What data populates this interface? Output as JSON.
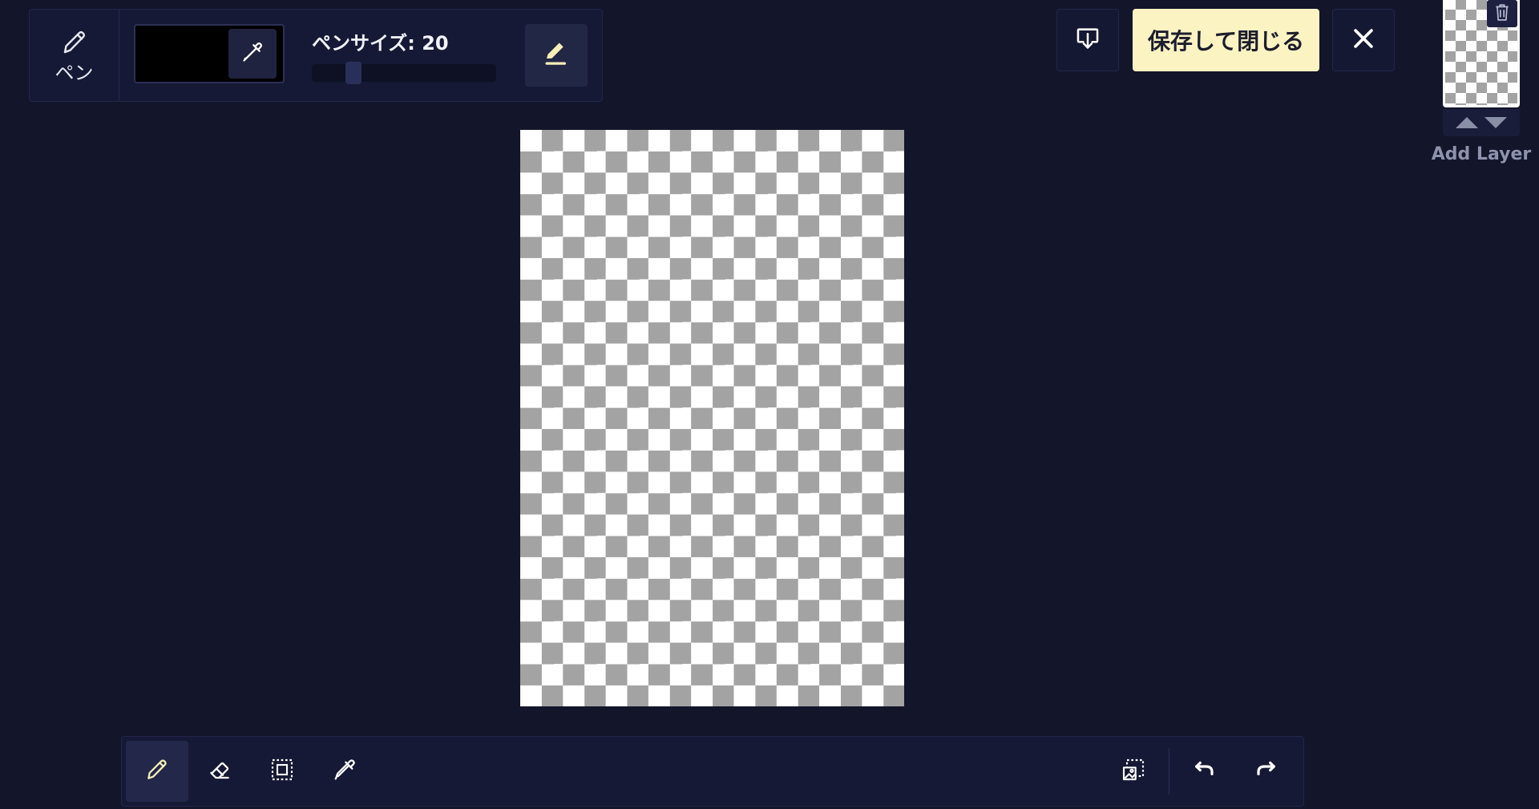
{
  "toolOptions": {
    "currentToolLabel": "ペン",
    "penSizeLabel": "ペンサイズ: 20",
    "penSizeValue": 20,
    "penSizeMax": 100,
    "currentColor": "#000000"
  },
  "actions": {
    "saveLabel": "保存して閉じる"
  },
  "layers": {
    "addLayerLabel": "Add Layer"
  },
  "colors": {
    "background": "#13152b",
    "panel": "#161935",
    "saveButton": "#fcf3c2",
    "accentIcon": "#f6efb8",
    "checkerDark": "#a3a3a3",
    "checkerLight": "#ffffff"
  },
  "icons": {
    "currentTool": "pen-icon",
    "swatchPicker": "eyedropper-icon",
    "penMode": "pen-underline-icon",
    "import": "import-icon",
    "close": "close-icon",
    "deleteLayer": "trash-icon",
    "bottomTools": [
      "pen-icon",
      "eraser-icon",
      "selection-icon",
      "eyedropper-icon"
    ],
    "bottomActions": [
      "image-selection-icon",
      "undo-icon",
      "redo-icon"
    ]
  },
  "bottomToolbar": {
    "activeTool": "pen"
  }
}
